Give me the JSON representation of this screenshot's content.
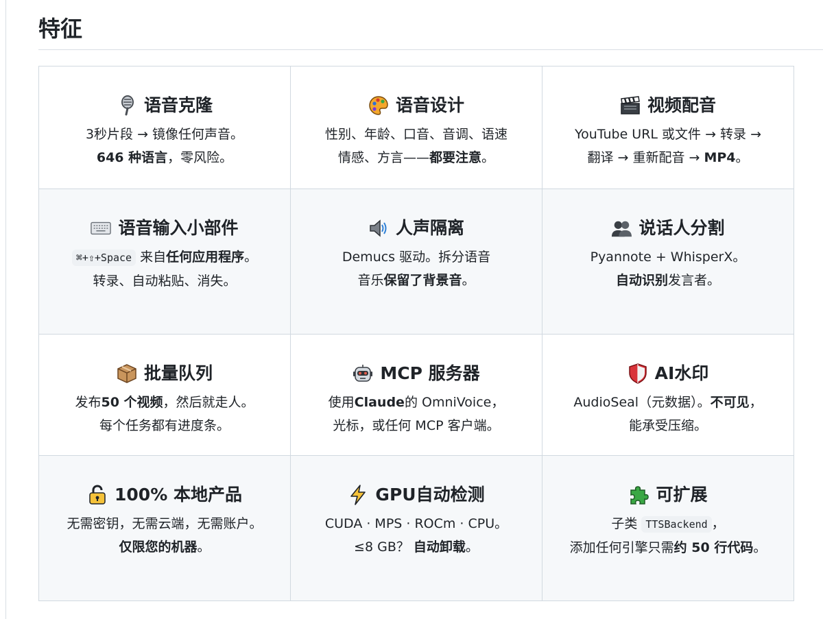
{
  "heading": "特征",
  "features": {
    "voice_clone": {
      "icon": "microphone-icon",
      "title": "语音克隆",
      "line1": "3秒片段 → 镜像任何声音。",
      "line2_bold": "646 种语言",
      "line2_rest": "，零风险。"
    },
    "voice_design": {
      "icon": "palette-icon",
      "title": "语音设计",
      "line1": "性别、年龄、口音、音调、语速",
      "line2_a": "情感、方言——",
      "line2_bold": "都要注意",
      "line2_end": "。"
    },
    "video_dubbing": {
      "icon": "clapperboard-icon",
      "title": "视频配音",
      "line1": "YouTube URL 或文件 → 转录 →",
      "line2_a": "翻译 → 重新配音 → ",
      "line2_bold": "MP4",
      "line2_end": "。"
    },
    "voice_input_widget": {
      "icon": "keyboard-icon",
      "title": "语音输入小部件",
      "shortcut": "⌘+⇧+Space",
      "line1_a": "来自",
      "line1_bold": "任何应用程序",
      "line1_end": "。",
      "line2": "转录、自动粘贴、消失。"
    },
    "vocal_separation": {
      "icon": "speaker-icon",
      "title": "人声隔离",
      "line1": "Demucs 驱动。拆分语音",
      "line2_a": "音乐",
      "line2_bold": "保留了背景音",
      "line2_end": "。"
    },
    "diarization": {
      "icon": "people-icon",
      "title": "说话人分割",
      "line1": "Pyannote + WhisperX。",
      "line2_bold": "自动识别",
      "line2_rest": "发言者。"
    },
    "batch_queue": {
      "icon": "package-icon",
      "title": "批量队列",
      "line1_a": "发布",
      "line1_bold": "50 个视频",
      "line1_rest": "，然后就走人。",
      "line2": "每个任务都有进度条。"
    },
    "mcp_server": {
      "icon": "robot-icon",
      "title": "MCP 服务器",
      "line1_a": "使用",
      "line1_bold": "Claude",
      "line1_rest": "的 OmniVoice，",
      "line2": "光标，或任何 MCP 客户端。"
    },
    "ai_watermark": {
      "icon": "shield-icon",
      "title": "AI水印",
      "line1_a": "AudioSeal（元数据）。",
      "line1_bold": "不可见",
      "line1_end": "，",
      "line2": "能承受压缩。"
    },
    "local_first": {
      "icon": "lock-icon",
      "title": "100% 本地产品",
      "line1": "无需密钥，无需云端，无需账户。",
      "line2_bold": "仅限您的机器",
      "line2_end": "。"
    },
    "gpu_detect": {
      "icon": "lightning-icon",
      "title": "GPU自动检测",
      "line1": "CUDA · MPS · ROCm · CPU。",
      "line2_a": "≤8 GB？ ",
      "line2_bold": "自动卸载",
      "line2_end": "。"
    },
    "extensible": {
      "icon": "puzzle-icon",
      "title": "可扩展",
      "line1_a": "子类 ",
      "code": "TTSBackend",
      "line1_end": "，",
      "line2_a": "添加任何引擎只需",
      "line2_bold": "约 50 行代码",
      "line2_end": "。"
    }
  }
}
